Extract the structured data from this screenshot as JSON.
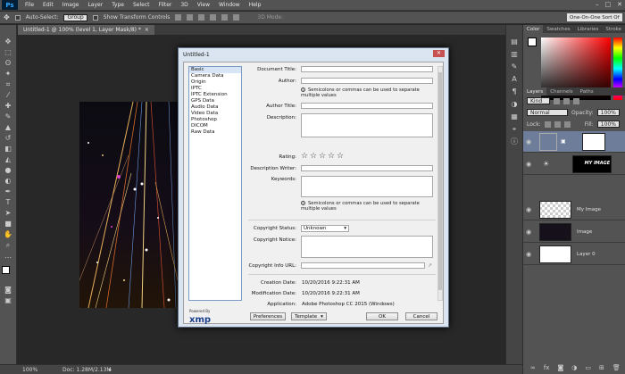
{
  "menubar": {
    "app_icon": "Ps",
    "items": [
      "File",
      "Edit",
      "Image",
      "Layer",
      "Type",
      "Select",
      "Filter",
      "3D",
      "View",
      "Window",
      "Help"
    ]
  },
  "optionsbar": {
    "auto_select_label": "Auto-Select:",
    "auto_select_value": "Group",
    "transform_label": "Show Transform Controls",
    "mode_3d": "3D Mode:",
    "workspace": "One-On-One Sort Of"
  },
  "document_tab": {
    "title": "Untitled-1 @ 100% (level 1, Layer Mask/8) *",
    "close": "×"
  },
  "statusbar": {
    "zoom": "100%",
    "doc": "Doc: 1.28M/2.13M"
  },
  "panels": {
    "color_tabs": [
      "Color",
      "Swatches",
      "Libraries",
      "Stroke"
    ],
    "layers_tabs": [
      "Layers",
      "Channels",
      "Paths"
    ],
    "kind_label": "Kind",
    "blend_mode": "Normal",
    "opacity_label": "Opacity:",
    "opacity_value": "100%",
    "lock_label": "Lock:",
    "fill_label": "Fill:",
    "fill_value": "100%",
    "layers": [
      {
        "name": ""
      },
      {
        "name": "MY IMAGE"
      },
      {
        "name": "My Image"
      },
      {
        "name": "Image"
      },
      {
        "name": "Layer 0"
      }
    ]
  },
  "dialog": {
    "title": "Untitled-1",
    "close": "✕",
    "categories": [
      "Basic",
      "Camera Data",
      "Origin",
      "IPTC",
      "IPTC Extension",
      "GPS Data",
      "Audio Data",
      "Video Data",
      "Photoshop",
      "DICOM",
      "Raw Data"
    ],
    "selected_category": "Basic",
    "labels": {
      "document_title": "Document Title:",
      "author": "Author:",
      "author_title": "Author Title:",
      "description": "Description:",
      "rating": "Rating:",
      "description_writer": "Description Writer:",
      "keywords": "Keywords:",
      "copyright_status": "Copyright Status:",
      "copyright_notice": "Copyright Notice:",
      "copyright_url": "Copyright Info URL:",
      "creation_date": "Creation Date:",
      "modification_date": "Modification Date:",
      "application": "Application:"
    },
    "hint": "Semicolons or commas can be used to separate multiple values",
    "copyright_status_value": "Unknown",
    "creation_date_value": "10/20/2016 9:22:31 AM",
    "modification_date_value": "10/20/2016 9:22:31 AM",
    "application_value": "Adobe Photoshop CC 2015 (Windows)",
    "rating_stars": 5,
    "rating_value": 0,
    "xmp_powered": "Powered By",
    "xmp_logo": "xmp",
    "buttons": {
      "preferences": "Preferences",
      "template": "Template",
      "ok": "OK",
      "cancel": "Cancel"
    }
  }
}
